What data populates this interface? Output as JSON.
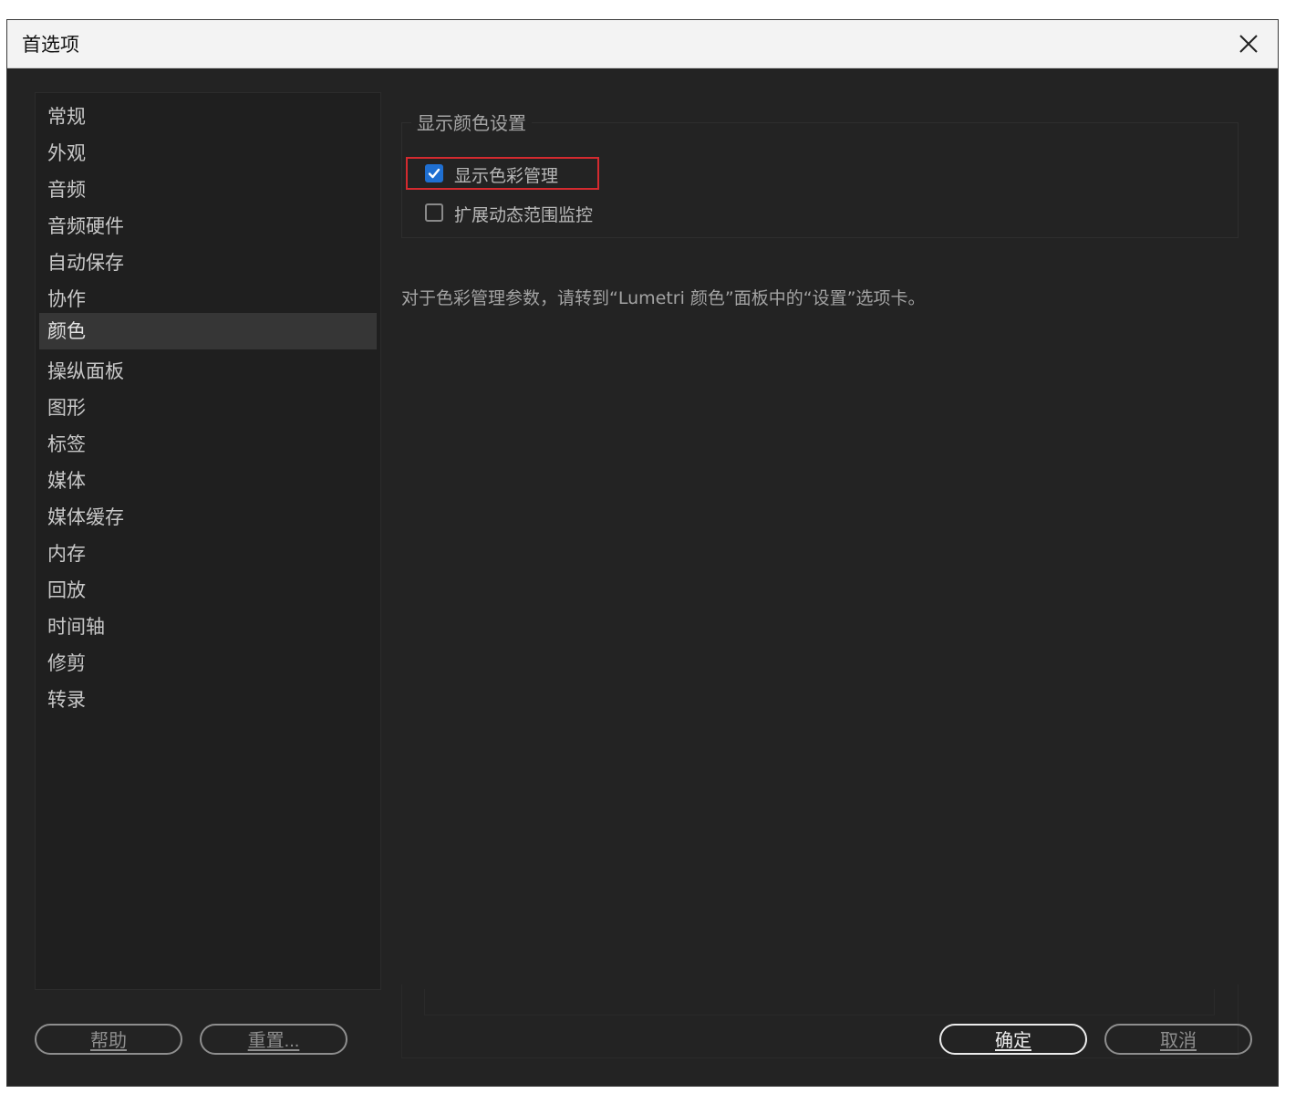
{
  "window": {
    "title": "首选项"
  },
  "sidebar": {
    "items": [
      {
        "label": "常规"
      },
      {
        "label": "外观"
      },
      {
        "label": "音频"
      },
      {
        "label": "音频硬件"
      },
      {
        "label": "自动保存"
      },
      {
        "label": "协作"
      },
      {
        "label": "颜色",
        "selected": true
      },
      {
        "label": "操纵面板"
      },
      {
        "label": "图形"
      },
      {
        "label": "标签"
      },
      {
        "label": "媒体"
      },
      {
        "label": "媒体缓存"
      },
      {
        "label": "内存"
      },
      {
        "label": "回放"
      },
      {
        "label": "时间轴"
      },
      {
        "label": "修剪"
      },
      {
        "label": "转录"
      }
    ]
  },
  "color_settings": {
    "group_title": "显示颜色设置",
    "display_color_management": {
      "label": "显示色彩管理",
      "checked": true
    },
    "extended_dynamic_range": {
      "label": "扩展动态范围监控",
      "checked": false
    },
    "info_text": "对于色彩管理参数，请转到“Lumetri 颜色”面板中的“设置”选项卡。"
  },
  "buttons": {
    "help": "帮助",
    "reset": "重置...",
    "ok": "确定",
    "cancel": "取消"
  },
  "colors": {
    "dialog_bg": "#232323",
    "accent": "#1f6fd1",
    "highlight": "#d42a2f"
  }
}
